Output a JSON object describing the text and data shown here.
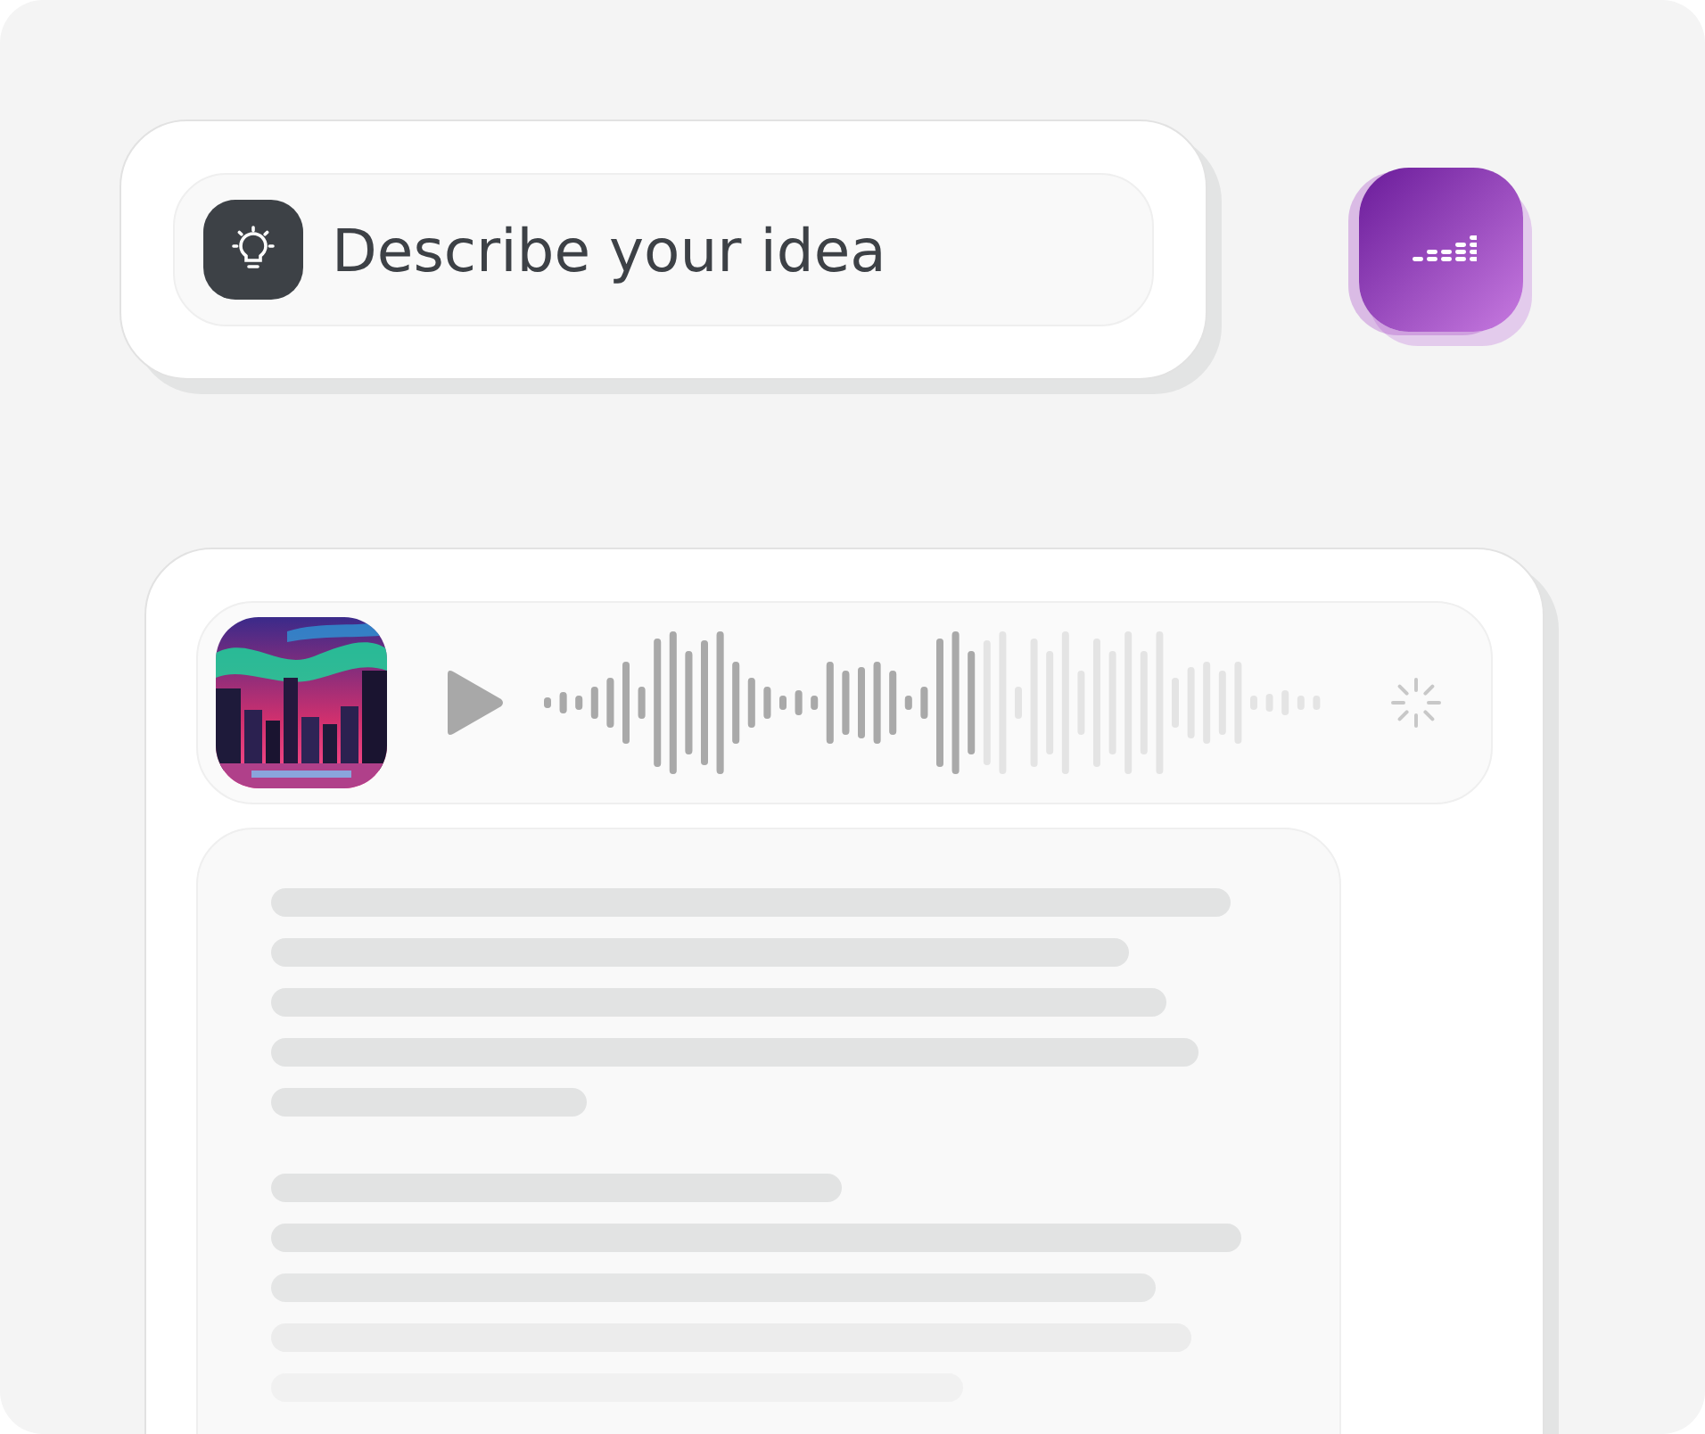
{
  "prompt": {
    "placeholder": "Describe your idea"
  },
  "player": {
    "level": 0.56
  }
}
